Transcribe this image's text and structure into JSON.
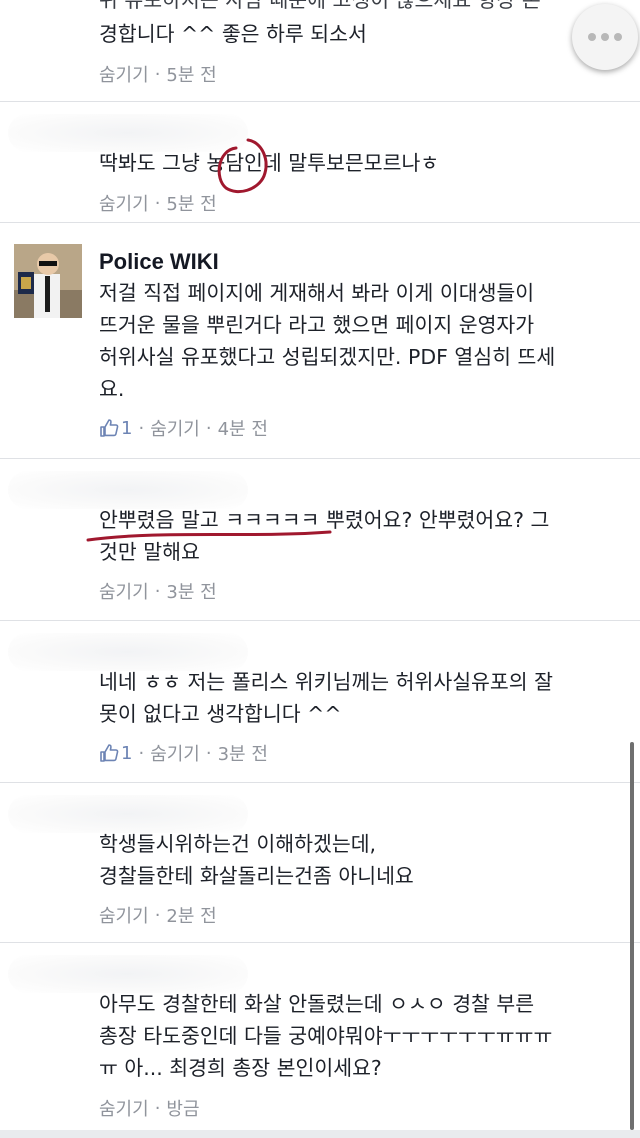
{
  "comments": [
    {
      "line_partial": "위 유포하지는 사람 때문에 고생이 많으세요 항상 존",
      "text": "경합니다 ^^ 좋은 하루 되소서",
      "hide": "숨기기",
      "sep": "·",
      "time": "5분 전"
    },
    {
      "text": "딱봐도 그냥 농담인데 말투보믄모르나ㅎ",
      "hide": "숨기기",
      "sep": "·",
      "time": "5분 전"
    },
    {
      "author": "Police WIKI",
      "text": "저걸 직접 페이지에 게재해서 봐라 이게 이대생들이\n뜨거운 물을 뿌린거다 라고 했으면 페이지 운영자가\n허위사실 유포했다고 성립되겠지만. PDF 열심히 뜨세\n요.",
      "likes": "1",
      "hide": "숨기기",
      "sep": "·",
      "time": "4분 전"
    },
    {
      "text": "안뿌렸음 말고 ㅋㅋㅋㅋㅋ 뿌렸어요? 안뿌렸어요? 그\n것만 말해요",
      "hide": "숨기기",
      "sep": "·",
      "time": "3분 전"
    },
    {
      "text": "네네 ㅎㅎ 저는 폴리스 위키님께는 허위사실유포의 잘\n못이 없다고 생각합니다 ^^",
      "likes": "1",
      "hide": "숨기기",
      "sep": "·",
      "time": "3분 전"
    },
    {
      "text": "학생들시위하는건 이해하겠는데,\n경찰들한테 화살돌리는건좀 아니네요",
      "hide": "숨기기",
      "sep": "·",
      "time": "2분 전"
    },
    {
      "text": "아무도 경찰한테 화살 안돌렸는데 ㅇㅅㅇ 경찰 부른\n총장 타도중인데 다들 궁예야뭐야ㅜㅜㅜㅜㅜㅜㅠㅠㅠ\nㅠ 아... 최경희 총장 본인이세요?",
      "hide": "숨기기",
      "sep": "·",
      "time": "방금"
    }
  ],
  "icons": {
    "like": "thumbs-up-icon",
    "more": "more-options-icon"
  },
  "colors": {
    "text": "#1d2129",
    "meta": "#90949c",
    "like": "#6d84b4",
    "annotation": "#a0182e"
  }
}
